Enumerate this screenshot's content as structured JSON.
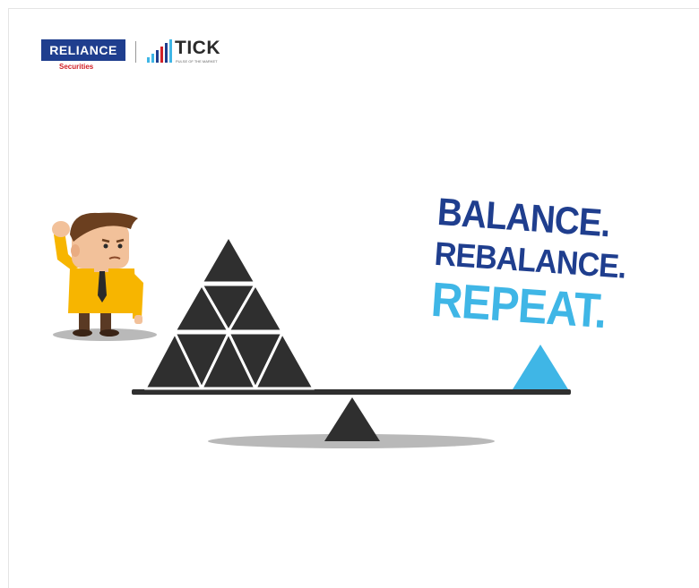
{
  "logos": {
    "reliance": "RELIANCE",
    "reliance_sub": "Securities",
    "tick": "TICK",
    "tick_sub": "PULSE OF THE MARKET"
  },
  "headline": {
    "line1": "BALANCE.",
    "line2": "REBALANCE.",
    "line3": "REPEAT."
  },
  "colors": {
    "dark_blue": "#1f3e8e",
    "light_blue": "#3fb6e6",
    "triangle": "#2f2f2f",
    "shirt": "#f7b500",
    "red": "#d12027"
  }
}
